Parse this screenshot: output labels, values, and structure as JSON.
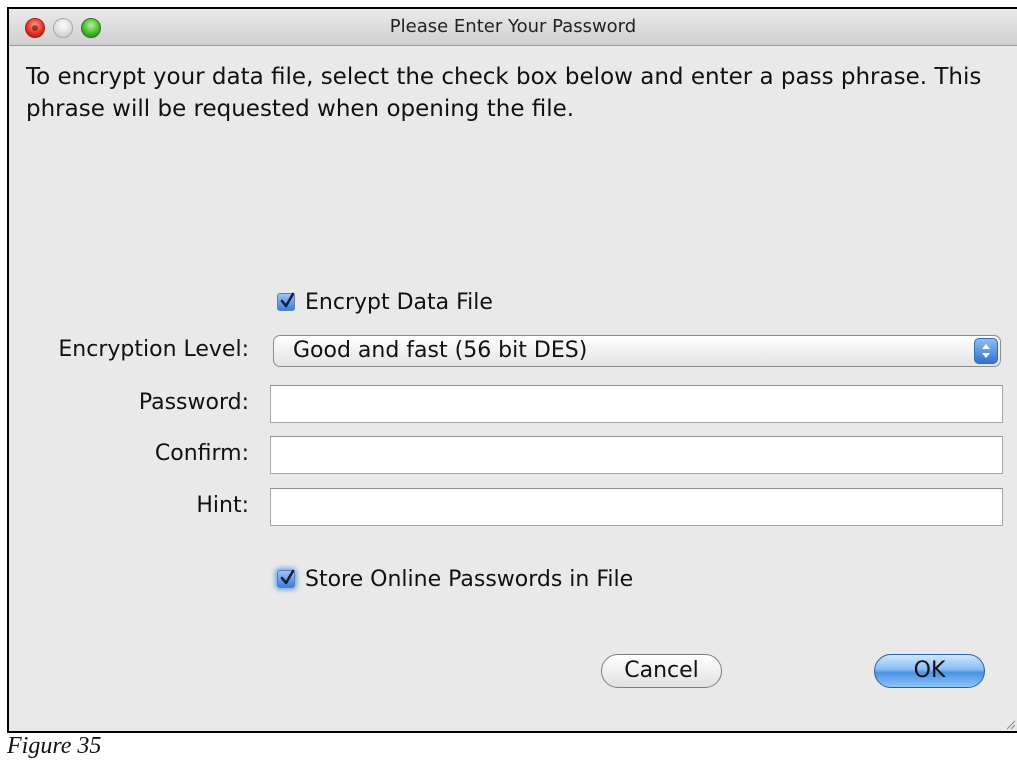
{
  "window": {
    "title": "Please Enter Your Password"
  },
  "message": "To encrypt your data file, select the check box below and enter a pass phrase.  This phrase will be requested when opening the file.",
  "form": {
    "encrypt_checkbox": {
      "label": "Encrypt Data File",
      "checked": true
    },
    "encryption_level": {
      "label": "Encryption Level:",
      "selected": "Good and fast (56 bit DES)"
    },
    "password": {
      "label": "Password:",
      "value": ""
    },
    "confirm": {
      "label": "Confirm:",
      "value": ""
    },
    "hint": {
      "label": "Hint:",
      "value": ""
    },
    "store_checkbox": {
      "label": "Store Online Passwords in File",
      "checked": true
    }
  },
  "buttons": {
    "cancel": "Cancel",
    "ok": "OK"
  },
  "caption": "Figure 35",
  "colors": {
    "window_bg": "#e9e9e9",
    "accent_blue": "#4a93e4",
    "close_red": "#e0291d",
    "zoom_green": "#3fb22a"
  }
}
